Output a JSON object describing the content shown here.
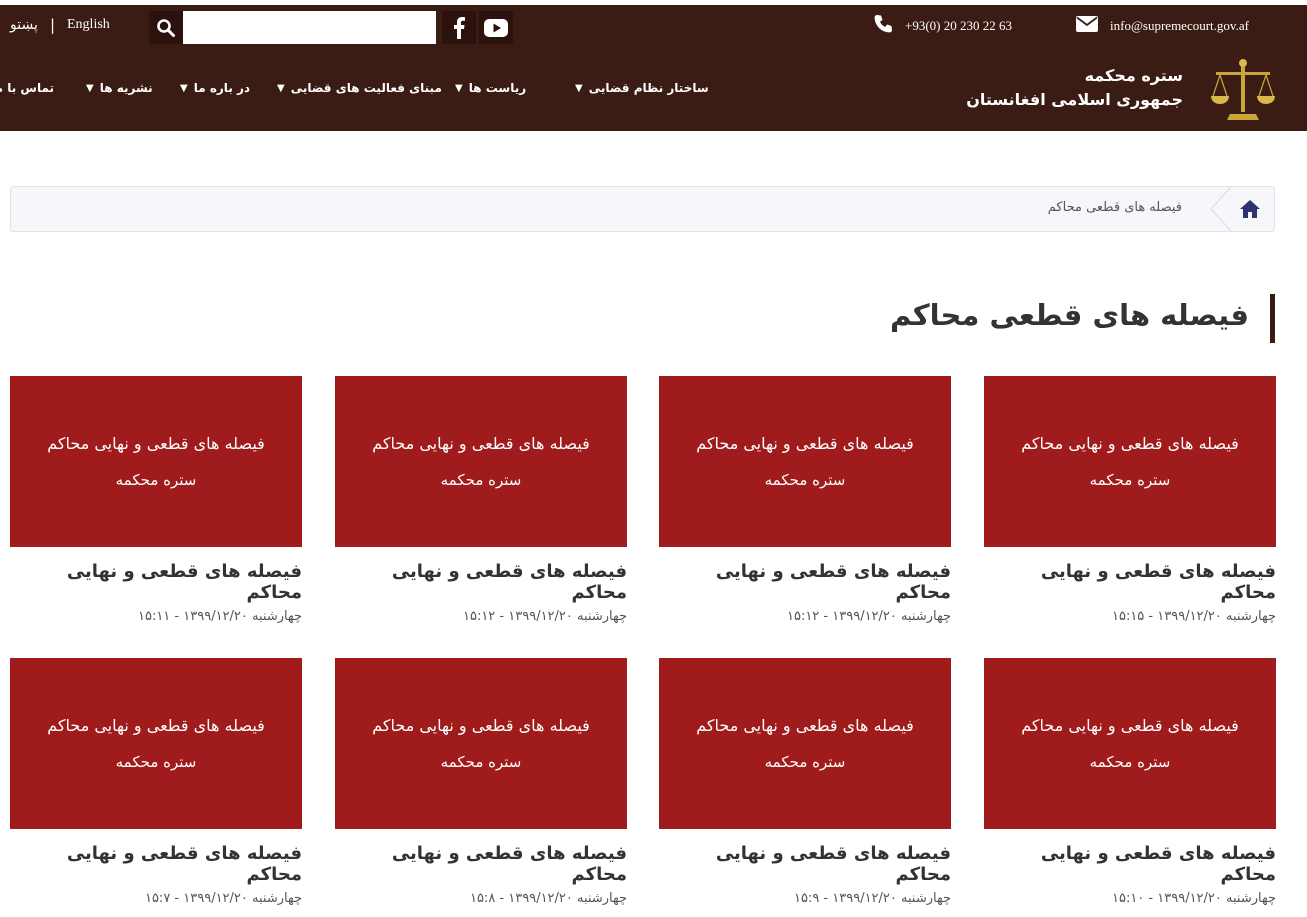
{
  "topbar": {
    "lang_pashto": "پښتو",
    "separator": "|",
    "lang_english": "English",
    "search_placeholder": "",
    "phone": "+93(0) 20 230 22 63",
    "email": "info@supremecourt.gov.af"
  },
  "brand": {
    "line1": "ستره محکمه",
    "line2": "جمهوری اسلامی افغانستان"
  },
  "nav": {
    "items": [
      {
        "label": "ساختار نظام قضایی"
      },
      {
        "label": "ریاست ها"
      },
      {
        "label": "مبنای فعالیت های قضایی"
      },
      {
        "label": "در باره ما"
      },
      {
        "label": "نشریه ها"
      },
      {
        "label": "تماس با ما"
      }
    ]
  },
  "breadcrumb": {
    "current": "فیصله های قطعی محاکم"
  },
  "page": {
    "title": "فیصله های قطعی محاکم"
  },
  "cards": [
    {
      "thumb_line1": "فیصله های قطعی و نهایی محاکم",
      "thumb_line2": "ستره محکمه",
      "title": "فیصله های قطعی و نهایی محاکم",
      "date": "چهارشنبه ۱۳۹۹/۱۲/۲۰ - ۱۵:۱۵"
    },
    {
      "thumb_line1": "فیصله های قطعی و نهایی محاکم",
      "thumb_line2": "ستره محکمه",
      "title": "فیصله های قطعی و نهایی محاکم",
      "date": "چهارشنبه ۱۳۹۹/۱۲/۲۰ - ۱۵:۱۲"
    },
    {
      "thumb_line1": "فیصله های قطعی و نهایی محاکم",
      "thumb_line2": "ستره محکمه",
      "title": "فیصله های قطعی و نهایی محاکم",
      "date": "چهارشنبه ۱۳۹۹/۱۲/۲۰ - ۱۵:۱۲"
    },
    {
      "thumb_line1": "فیصله های قطعی و نهایی محاکم",
      "thumb_line2": "ستره محکمه",
      "title": "فیصله های قطعی و نهایی محاکم",
      "date": "چهارشنبه ۱۳۹۹/۱۲/۲۰ - ۱۵:۱۱"
    },
    {
      "thumb_line1": "فیصله های قطعی و نهایی محاکم",
      "thumb_line2": "ستره محکمه",
      "title": "فیصله های قطعی و نهایی محاکم",
      "date": "چهارشنبه ۱۳۹۹/۱۲/۲۰ - ۱۵:۱۰"
    },
    {
      "thumb_line1": "فیصله های قطعی و نهایی محاکم",
      "thumb_line2": "ستره محکمه",
      "title": "فیصله های قطعی و نهایی محاکم",
      "date": "چهارشنبه ۱۳۹۹/۱۲/۲۰ - ۱۵:۹"
    },
    {
      "thumb_line1": "فیصله های قطعی و نهایی محاکم",
      "thumb_line2": "ستره محکمه",
      "title": "فیصله های قطعی و نهایی محاکم",
      "date": "چهارشنبه ۱۳۹۹/۱۲/۲۰ - ۱۵:۸"
    },
    {
      "thumb_line1": "فیصله های قطعی و نهایی محاکم",
      "thumb_line2": "ستره محکمه",
      "title": "فیصله های قطعی و نهایی محاکم",
      "date": "چهارشنبه ۱۳۹۹/۱۲/۲۰ - ۱۵:۷"
    }
  ],
  "colors": {
    "header_bg": "#3b1c15",
    "card_red": "#a01b1b"
  },
  "icons": [
    "search-icon",
    "facebook-icon",
    "youtube-icon",
    "phone-icon",
    "envelope-icon",
    "scales-logo-icon",
    "home-icon",
    "chevron-down-icon"
  ]
}
